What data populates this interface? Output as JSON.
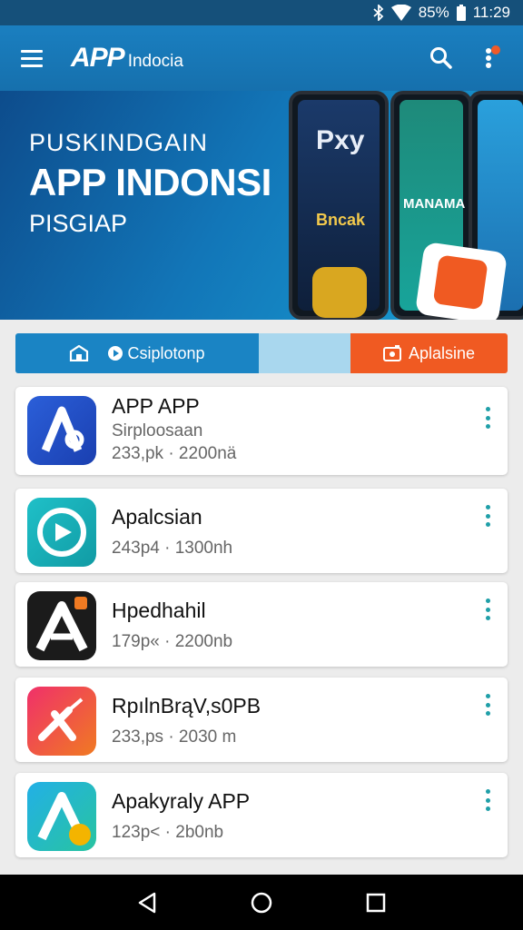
{
  "status_bar": {
    "battery": "85%",
    "time": "11:29"
  },
  "header": {
    "logo_main": "APP",
    "logo_sub": "Indocia"
  },
  "banner": {
    "kicker": "PUSKINDGAIN",
    "title": "APP INDONSI",
    "subtitle": "PISGIAP",
    "phone_labels": [
      "Pxy",
      "Bncak",
      "MANAMA"
    ]
  },
  "tabs": [
    {
      "label": "Csiplotonp"
    },
    {
      "label": ""
    },
    {
      "label": "Aplalsine"
    }
  ],
  "apps": [
    {
      "title": "APP APP",
      "subtitle": "Sirploosaan",
      "meta": "233,pk · 2200nä"
    },
    {
      "title": "Apalcsian",
      "subtitle": "",
      "meta": "243p4 · 1300nh"
    },
    {
      "title": "Hpedhahil",
      "subtitle": "",
      "meta": "179p« · 2200nb"
    },
    {
      "title": "RpılnBrąV,s0PB",
      "subtitle": "",
      "meta": "233,ps · 2030 m"
    },
    {
      "title": "Apakyraly APP",
      "subtitle": "",
      "meta": "123p< · 2b0nb"
    }
  ],
  "icons": {
    "status": [
      "bluetooth-icon",
      "wifi-icon",
      "battery-icon"
    ],
    "header": [
      "menu-icon",
      "search-icon",
      "more-vertical-icon"
    ],
    "nav": [
      "back-icon",
      "home-icon",
      "recents-icon"
    ]
  },
  "colors": {
    "primary": "#1a7fc0",
    "accent": "#f05a22",
    "teal": "#1f9fa8"
  }
}
